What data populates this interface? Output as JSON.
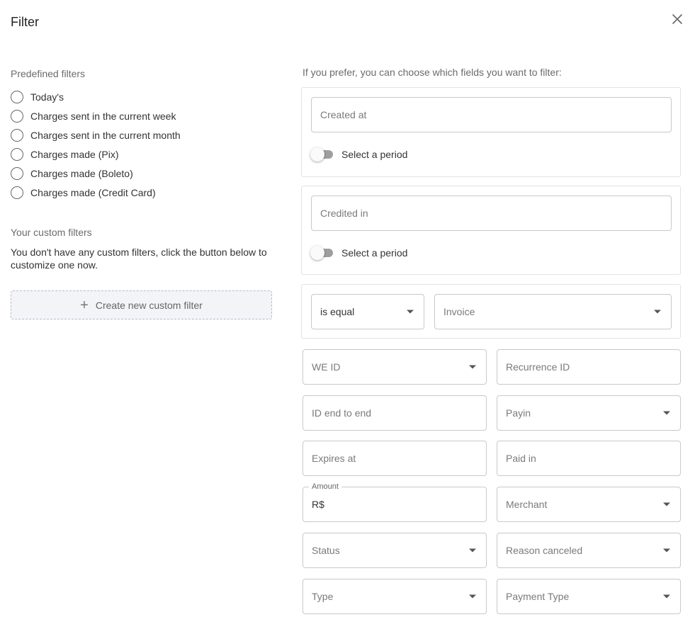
{
  "dialog": {
    "title": "Filter"
  },
  "predefined": {
    "heading": "Predefined filters",
    "options": [
      {
        "label": "Today's"
      },
      {
        "label": "Charges sent in the current week"
      },
      {
        "label": "Charges sent in the current month"
      },
      {
        "label": "Charges made (Pix)"
      },
      {
        "label": "Charges made (Boleto)"
      },
      {
        "label": "Charges made (Credit Card)"
      }
    ]
  },
  "custom": {
    "heading": "Your custom filters",
    "empty_message": "You don't have any custom filters, click the button below to customize one now.",
    "create_button": "Create new custom filter"
  },
  "fields": {
    "intro": "If you prefer, you can choose which fields you want to filter:",
    "created_at": {
      "placeholder": "Created at",
      "toggle_label": "Select a period"
    },
    "credited_in": {
      "placeholder": "Credited in",
      "toggle_label": "Select a period"
    },
    "comparison": {
      "operator": "is equal",
      "field": "Invoice"
    },
    "we_id": "WE ID",
    "recurrence_id": "Recurrence ID",
    "id_end_to_end": "ID end to end",
    "payin": "Payin",
    "expires_at": "Expires at",
    "paid_in": "Paid in",
    "amount": {
      "label": "Amount",
      "prefix": "R$"
    },
    "merchant": "Merchant",
    "status": "Status",
    "reason_canceled": "Reason canceled",
    "type": "Type",
    "payment_type": "Payment Type"
  }
}
